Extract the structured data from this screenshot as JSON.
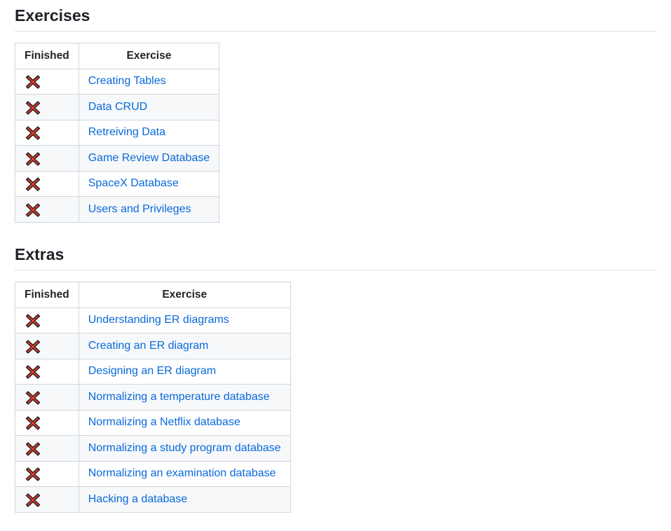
{
  "sections": [
    {
      "title": "Exercises",
      "headers": {
        "finished": "Finished",
        "exercise": "Exercise"
      },
      "rows": [
        {
          "status_icon": "red-x-icon",
          "label": "Creating Tables"
        },
        {
          "status_icon": "red-x-icon",
          "label": "Data CRUD"
        },
        {
          "status_icon": "red-x-icon",
          "label": "Retreiving Data"
        },
        {
          "status_icon": "red-x-icon",
          "label": "Game Review Database"
        },
        {
          "status_icon": "red-x-icon",
          "label": "SpaceX Database"
        },
        {
          "status_icon": "red-x-icon",
          "label": "Users and Privileges"
        }
      ]
    },
    {
      "title": "Extras",
      "headers": {
        "finished": "Finished",
        "exercise": "Exercise"
      },
      "rows": [
        {
          "status_icon": "red-x-icon",
          "label": "Understanding ER diagrams"
        },
        {
          "status_icon": "red-x-icon",
          "label": "Creating an ER diagram"
        },
        {
          "status_icon": "red-x-icon",
          "label": "Designing an ER diagram"
        },
        {
          "status_icon": "red-x-icon",
          "label": "Normalizing a temperature database"
        },
        {
          "status_icon": "red-x-icon",
          "label": "Normalizing a Netflix database"
        },
        {
          "status_icon": "red-x-icon",
          "label": "Normalizing a study program database"
        },
        {
          "status_icon": "red-x-icon",
          "label": "Normalizing an examination database"
        },
        {
          "status_icon": "red-x-icon",
          "label": "Hacking a database"
        }
      ]
    }
  ],
  "colors": {
    "link": "#0969da",
    "x_fill": "#d83b2b",
    "x_outline": "#1a1a1a",
    "border": "#d0d7de",
    "stripe": "#f6f8fa"
  }
}
